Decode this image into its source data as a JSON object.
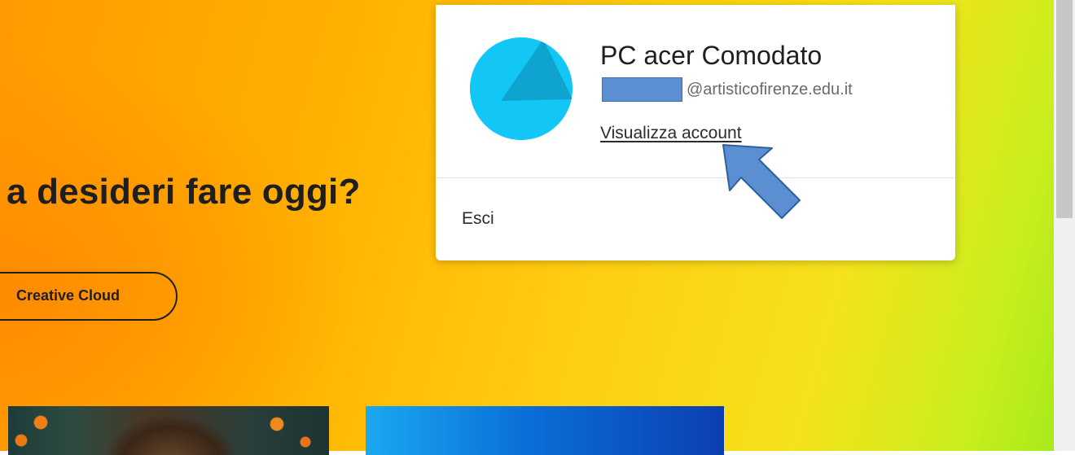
{
  "hero": {
    "heading": "a desideri fare oggi?",
    "cc_button_label": "Creative Cloud"
  },
  "account_menu": {
    "display_name": "PC acer Comodato",
    "email_domain": "@artisticofirenze.edu.it",
    "view_account_label": "Visualizza account",
    "sign_out_label": "Esci"
  },
  "colors": {
    "avatar": "#12c7f5",
    "annotation_arrow": "#5b8fd1",
    "redaction_box": "#5b8fd1"
  },
  "icons": {
    "avatar": "avatar-icon",
    "annotation": "arrow-up-left-icon"
  }
}
